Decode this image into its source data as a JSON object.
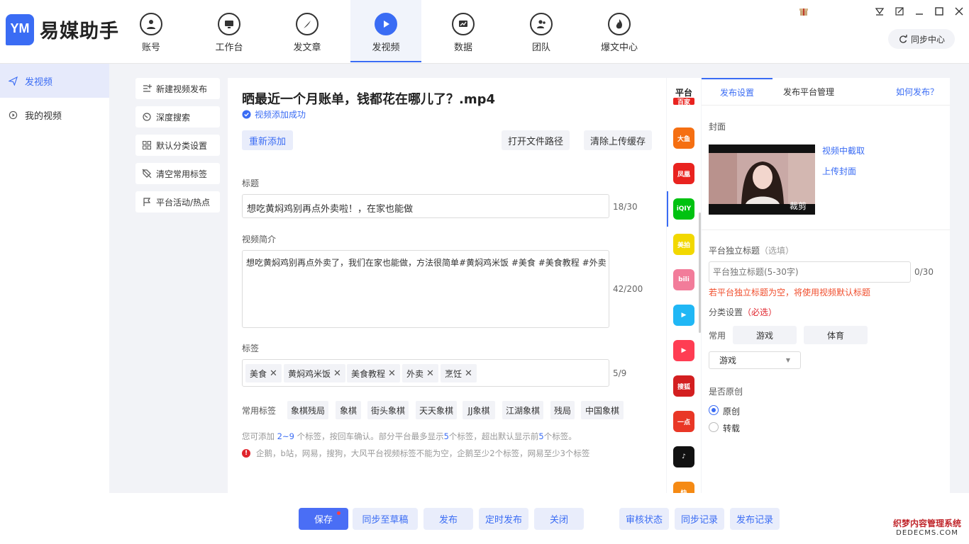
{
  "app": {
    "logo_text": "YM",
    "title": "易媒助手"
  },
  "nav": [
    {
      "label": "账号"
    },
    {
      "label": "工作台"
    },
    {
      "label": "发文章"
    },
    {
      "label": "发视频"
    },
    {
      "label": "数据"
    },
    {
      "label": "团队"
    },
    {
      "label": "爆文中心"
    }
  ],
  "header": {
    "sync_center": "同步中心"
  },
  "sidebar": {
    "items": [
      {
        "label": "发视频"
      },
      {
        "label": "我的视频"
      }
    ]
  },
  "tools": [
    {
      "label": "新建视频发布"
    },
    {
      "label": "深度搜索"
    },
    {
      "label": "默认分类设置"
    },
    {
      "label": "清空常用标签"
    },
    {
      "label": "平台活动/热点"
    }
  ],
  "video": {
    "filename": "晒最近一个月账单，钱都花在哪儿了？.mp4",
    "status": "视频添加成功",
    "re_add": "重新添加",
    "open_path": "打开文件路径",
    "clear_cache": "清除上传缓存"
  },
  "form": {
    "title_label": "标题",
    "title_value": "想吃黄焖鸡别再点外卖啦！，在家也能做",
    "title_count": "18/30",
    "desc_label": "视频简介",
    "desc_value": "想吃黄焖鸡别再点外卖了，我们在家也能做，方法很简单#黄焖鸡米饭 #美食 #美食教程 #外卖",
    "desc_count": "42/200",
    "tags_label": "标签",
    "tags": [
      "美食",
      "黄焖鸡米饭",
      "美食教程",
      "外卖",
      "烹饪"
    ],
    "tags_count": "5/9",
    "common_tags_label": "常用标签",
    "common_tags": [
      "象棋残局",
      "象棋",
      "街头象棋",
      "天天象棋",
      "JJ象棋",
      "江湖象棋",
      "残局",
      "中国象棋"
    ],
    "hint1": {
      "pre": "您可添加 ",
      "range": "2~9",
      "mid1": " 个标签，按回车确认。部分平台最多显示",
      "n1": "5",
      "mid2": "个标签，超出默认显示前",
      "n2": "5",
      "post": "个标签。"
    },
    "hint2": "企鹅，b站，网易，搜狗，大风平台视频标签不能为空，企鹅至少2个标签，网易至少3个标签"
  },
  "platforms": {
    "header": "平台",
    "items": [
      {
        "name": "baijiahao",
        "label": "百家",
        "color": "#e9231f"
      },
      {
        "name": "dayu",
        "label": "大鱼",
        "color": "#f56f12"
      },
      {
        "name": "fenghuang",
        "label": "凤凰",
        "color": "#e9231f"
      },
      {
        "name": "iqiyi",
        "label": "iQIY",
        "color": "#00c211"
      },
      {
        "name": "meipai",
        "label": "美拍",
        "color": "#f2d800"
      },
      {
        "name": "bilibili",
        "label": "bili",
        "color": "#f27c9a"
      },
      {
        "name": "tencent-video",
        "label": "▶",
        "color": "#20b7f5"
      },
      {
        "name": "xigua",
        "label": "▶",
        "color": "#ff3d53"
      },
      {
        "name": "souhu",
        "label": "搜狐",
        "color": "#d31f20"
      },
      {
        "name": "yidian",
        "label": "一点",
        "color": "#e93726"
      },
      {
        "name": "douyin",
        "label": "♪",
        "color": "#111111"
      },
      {
        "name": "kuaishou",
        "label": "快",
        "color": "#f58a14"
      }
    ]
  },
  "right": {
    "tab_publish": "发布设置",
    "tab_manage": "发布平台管理",
    "how_publish": "如何发布？",
    "cover_label": "封面",
    "cover_crop": "裁剪",
    "cover_from_video": "视频中截取",
    "cover_upload": "上传封面",
    "indep_title_label": "平台独立标题",
    "indep_title_optional": "（选填）",
    "indep_title_placeholder": "平台独立标题(5-30字)",
    "indep_title_count": "0/30",
    "indep_warning": "若平台独立标题为空，将使用视频默认标题",
    "category_label": "分类设置",
    "category_required": "（必选）",
    "common_label": "常用",
    "cat_game": "游戏",
    "cat_sport": "体育",
    "category_selected": "游戏",
    "original_label": "是否原创",
    "original_yes": "原创",
    "original_no": "转载",
    "original_checked": "原创"
  },
  "bottom": {
    "save": "保存",
    "sync_draft": "同步至草稿",
    "publish": "发布",
    "schedule": "定时发布",
    "close": "关闭",
    "review": "审核状态",
    "sync_log": "同步记录",
    "publish_log": "发布记录"
  },
  "watermark": {
    "line1": "织梦内容管理系统",
    "line2": "DEDECMS.COM"
  },
  "colors": {
    "accent": "#3a6cf4",
    "warn": "#f04d2c",
    "required": "#e0242c"
  }
}
